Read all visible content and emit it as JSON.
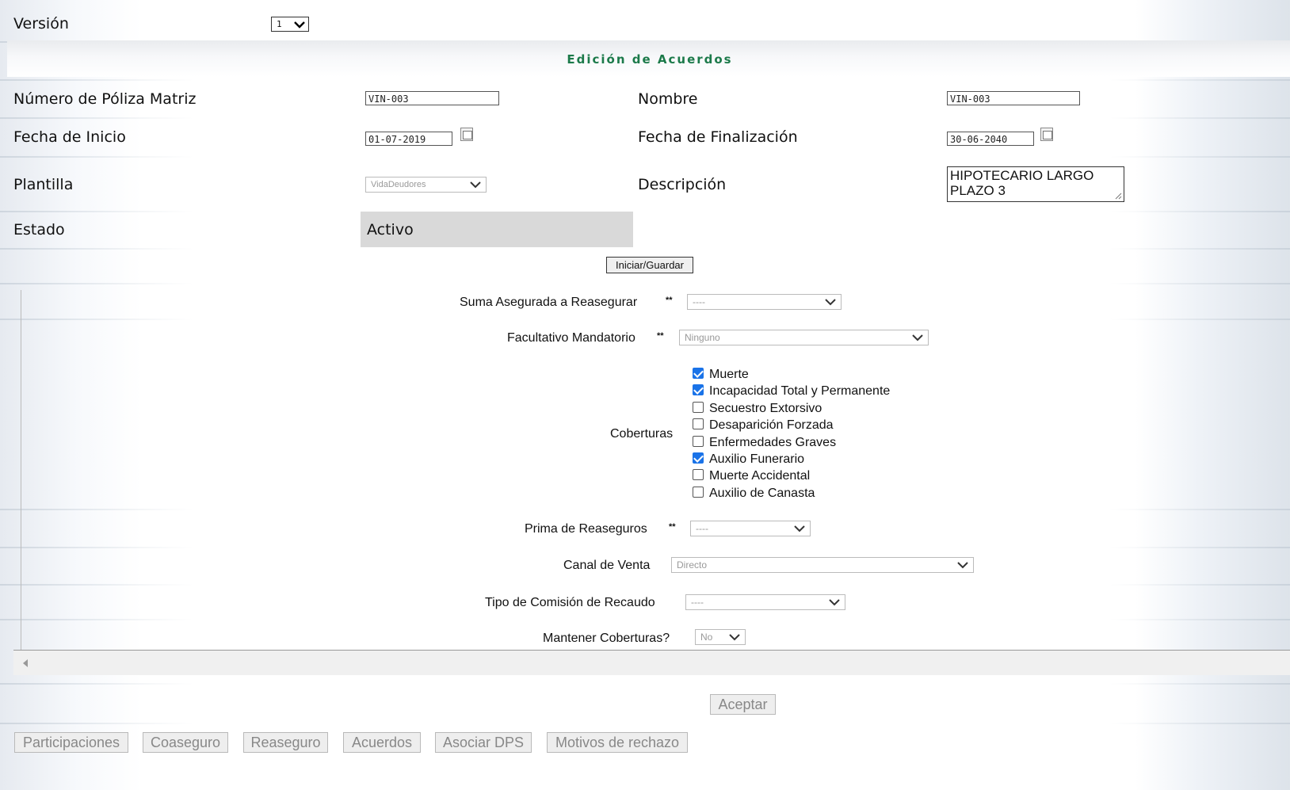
{
  "header": {
    "version_label": "Versión",
    "version_value": "1"
  },
  "section_title": "Edición de Acuerdos",
  "form": {
    "poliza_label": "Número de Póliza Matriz",
    "poliza_value": "VIN-003",
    "nombre_label": "Nombre",
    "nombre_value": "VIN-003",
    "fecha_inicio_label": "Fecha de Inicio",
    "fecha_inicio_value": "01-07-2019",
    "fecha_fin_label": "Fecha de Finalización",
    "fecha_fin_value": "30-06-2040",
    "plantilla_label": "Plantilla",
    "plantilla_value": "VidaDeudores",
    "descripcion_label": "Descripción",
    "descripcion_value": "HIPOTECARIO LARGO PLAZO 3",
    "estado_label": "Estado",
    "estado_value": "Activo",
    "iniciar_button": "Iniciar/Guardar"
  },
  "agreement": {
    "suma_label": "Suma Asegurada a Reasegurar",
    "suma_value": "----",
    "facultativo_label": "Facultativo Mandatorio",
    "facultativo_value": "Ninguno",
    "required_mark": "**",
    "coberturas_label": "Coberturas",
    "coberturas": [
      {
        "label": "Muerte",
        "checked": true
      },
      {
        "label": "Incapacidad Total y Permanente",
        "checked": true
      },
      {
        "label": "Secuestro Extorsivo",
        "checked": false
      },
      {
        "label": "Desaparición Forzada",
        "checked": false
      },
      {
        "label": "Enfermedades Graves",
        "checked": false
      },
      {
        "label": "Auxilio Funerario",
        "checked": true
      },
      {
        "label": "Muerte Accidental",
        "checked": false
      },
      {
        "label": "Auxilio de Canasta",
        "checked": false
      }
    ],
    "prima_label": "Prima de Reaseguros",
    "prima_value": "----",
    "canal_label": "Canal de Venta",
    "canal_value": "Directo",
    "tipo_comision_label": "Tipo de Comisión de Recaudo",
    "tipo_comision_value": "----",
    "mantener_label": "Mantener Coberturas?",
    "mantener_value": "No"
  },
  "aceptar_button": "Aceptar",
  "bottom_tabs": [
    "Participaciones",
    "Coaseguro",
    "Reaseguro",
    "Acuerdos",
    "Asociar DPS",
    "Motivos de rechazo"
  ]
}
